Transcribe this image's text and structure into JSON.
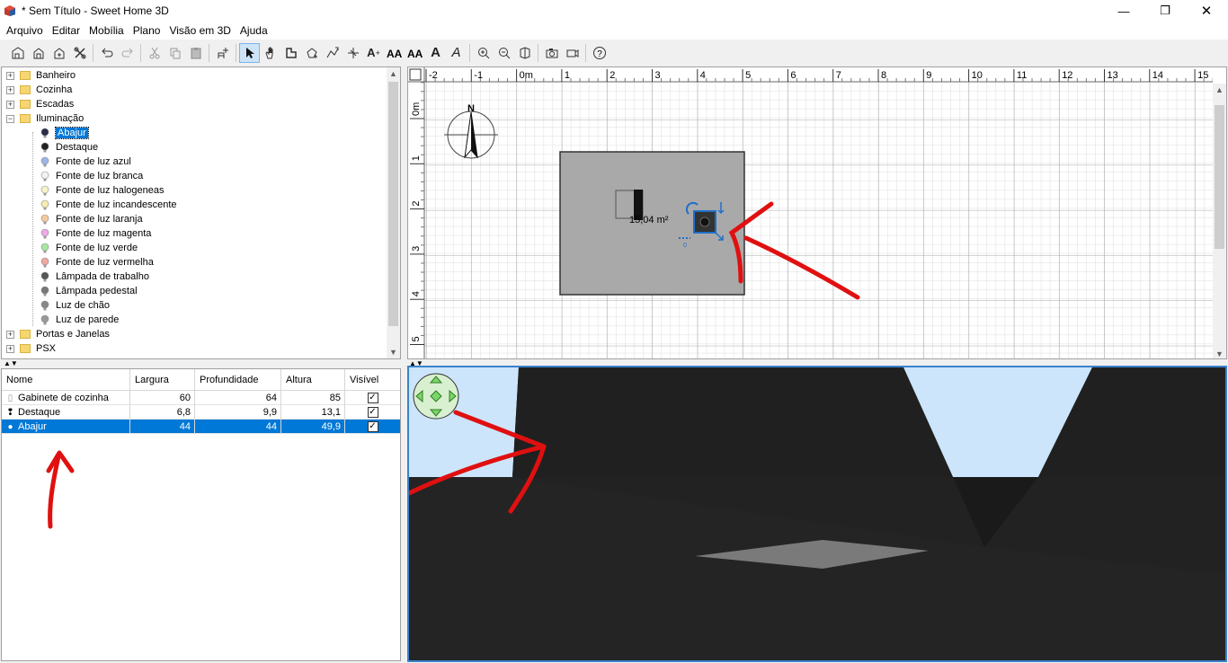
{
  "window": {
    "title": "* Sem Título - Sweet Home 3D",
    "minimize": "—",
    "maximize": "❐",
    "close": "✕"
  },
  "menu": [
    "Arquivo",
    "Editar",
    "Mobília",
    "Plano",
    "Visão em 3D",
    "Ajuda"
  ],
  "toolbar": {
    "text_a1": "A",
    "text_a2": "A",
    "text_a3": "A",
    "text_a4": "A",
    "buttons": [
      "new-home-icon",
      "open-icon",
      "save-icon",
      "preferences-icon",
      "undo-icon",
      "redo-icon",
      "cut-icon",
      "copy-icon",
      "paste-icon",
      "add-furniture-icon",
      "select-mode-icon",
      "pan-mode-icon",
      "create-walls-icon",
      "create-rooms-icon",
      "create-polylines-icon",
      "create-dimensions-icon",
      "add-text-icon",
      "increase-text-icon",
      "decrease-text-icon",
      "bold-icon",
      "italic-icon",
      "zoom-in-icon",
      "zoom-out-icon",
      "store-point-icon",
      "photo-icon",
      "video-icon",
      "help-icon"
    ]
  },
  "catalog": {
    "categories_top": [
      "Banheiro",
      "Cozinha",
      "Escadas",
      "Iluminação"
    ],
    "lighting_items": [
      "Abajur",
      "Destaque",
      "Fonte de luz azul",
      "Fonte de luz branca",
      "Fonte de luz halogeneas",
      "Fonte de luz incandescente",
      "Fonte de luz laranja",
      "Fonte de luz magenta",
      "Fonte de luz verde",
      "Fonte de luz vermelha",
      "Lâmpada de trabalho",
      "Lâmpada pedestal",
      "Luz de chão",
      "Luz de parede"
    ],
    "categories_bottom": [
      "Portas e Janelas",
      "PSX"
    ],
    "selected": "Abajur",
    "icon_colors": [
      "#2b2b4a",
      "#222222",
      "#9fb5e8",
      "#f2f2f2",
      "#f7f3c8",
      "#f5ecb0",
      "#f5c9a0",
      "#f0a8e8",
      "#a8e8a0",
      "#f0a8a0",
      "#555555",
      "#777777",
      "#888888",
      "#999999"
    ]
  },
  "furniture_table": {
    "headers": [
      "Nome",
      "Largura",
      "Profundidade",
      "Altura",
      "Visível"
    ],
    "rows": [
      {
        "name": "Gabinete de cozinha",
        "width": "60",
        "depth": "64",
        "height": "85",
        "visible": "✓"
      },
      {
        "name": "Destaque",
        "width": "6,8",
        "depth": "9,9",
        "height": "13,1",
        "visible": "✓"
      },
      {
        "name": "Abajur",
        "width": "44",
        "depth": "44",
        "height": "49,9",
        "visible": "✓"
      }
    ]
  },
  "plan": {
    "x_ticks": [
      "-2",
      "-1",
      "0m",
      "1",
      "2",
      "3",
      "4",
      "5",
      "6",
      "7",
      "8",
      "9",
      "10",
      "11",
      "12",
      "13",
      "14",
      "15"
    ],
    "y_ticks": [
      "0m",
      "1",
      "2",
      "3",
      "4",
      "5"
    ],
    "room_area": "15,04 m²",
    "compass_label": "N",
    "small_label": "0"
  }
}
